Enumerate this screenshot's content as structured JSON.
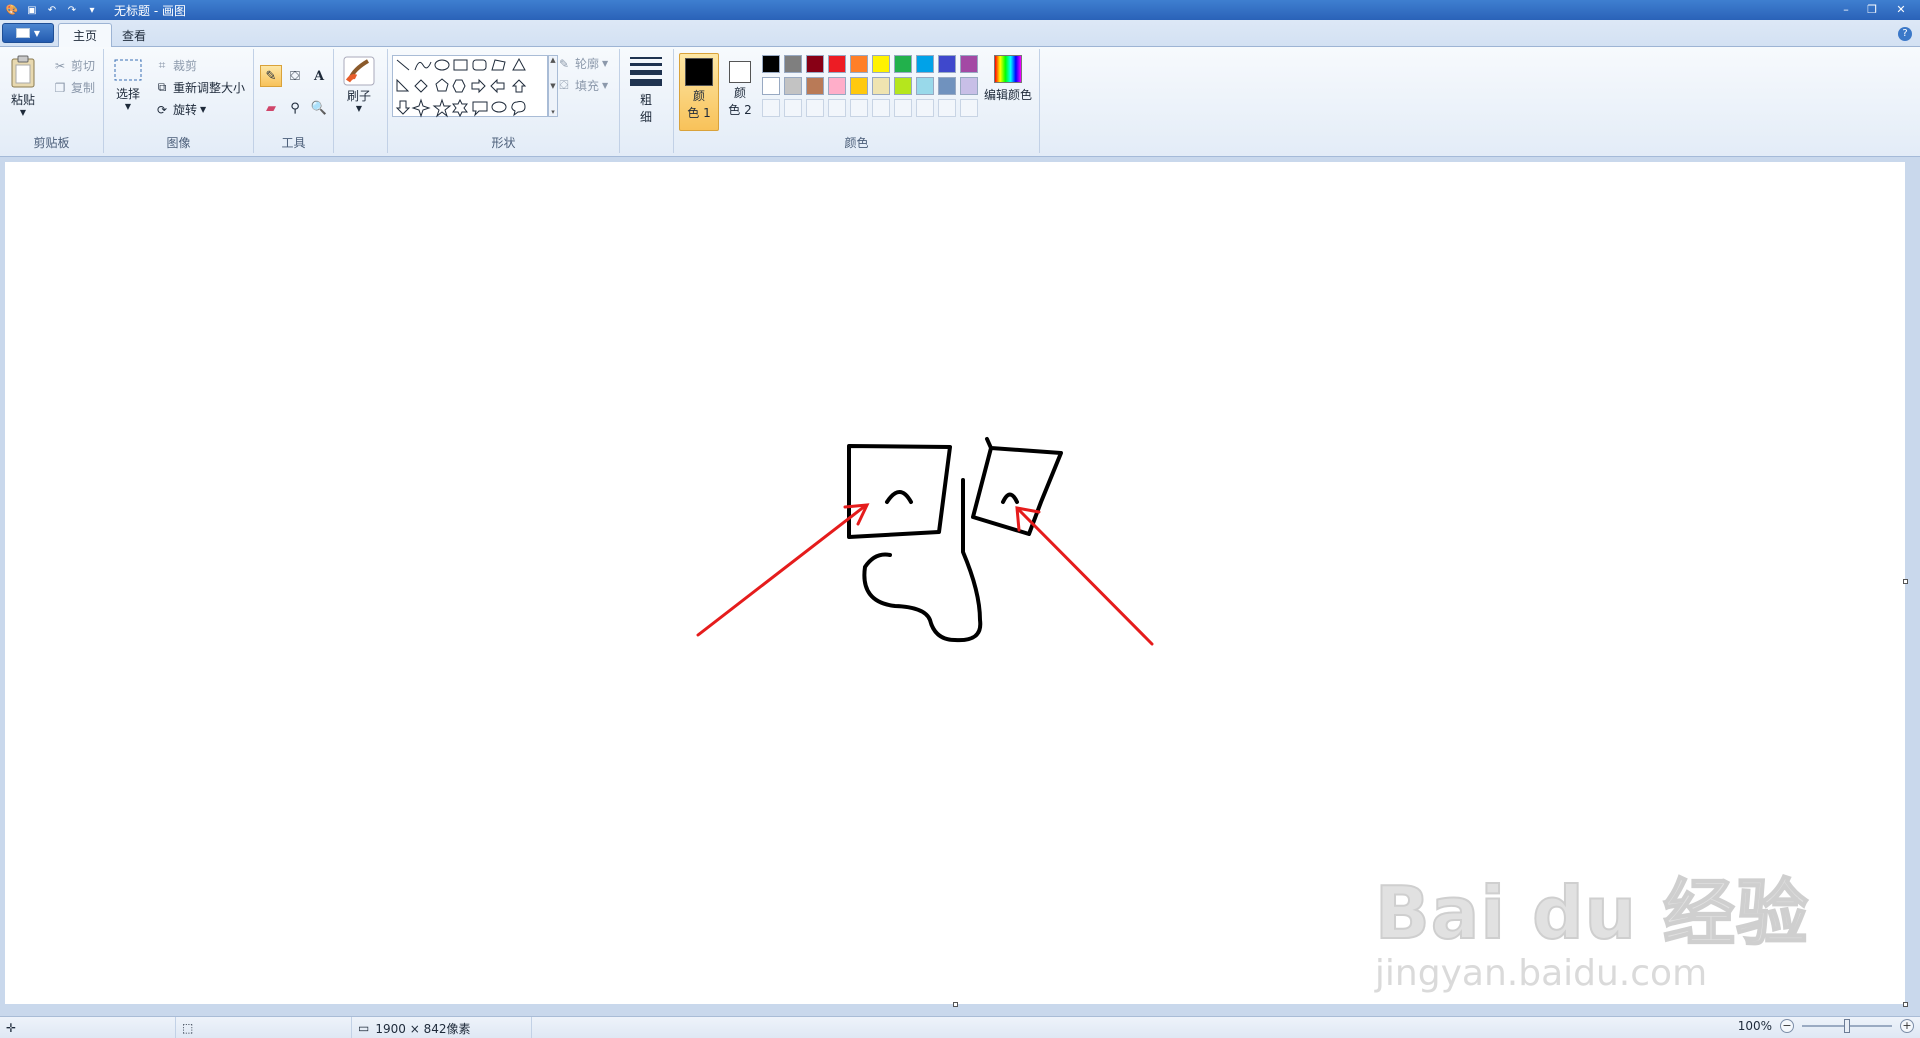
{
  "window": {
    "title": "无标题 - 画图",
    "controls": {
      "minimize": "–",
      "restore": "❐",
      "close": "✕"
    }
  },
  "tabs": [
    {
      "label": "主页",
      "active": true
    },
    {
      "label": "查看",
      "active": false
    }
  ],
  "ribbon": {
    "clipboard": {
      "paste": "粘贴",
      "cut": "剪切",
      "copy": "复制",
      "group": "剪贴板"
    },
    "image": {
      "select": "选择",
      "crop": "裁剪",
      "resize": "重新调整大小",
      "rotate": "旋转",
      "group": "图像"
    },
    "tools": {
      "group": "工具",
      "text_glyph": "A"
    },
    "brushes": {
      "label": "刷子"
    },
    "shapes": {
      "outline": "轮廓",
      "fill": "填充",
      "group": "形状"
    },
    "size": {
      "label_line1": "粗",
      "label_line2": "细"
    },
    "colors": {
      "color1_line1": "颜",
      "color1_line2": "色 1",
      "color1_value": "#000000",
      "color2_line1": "颜",
      "color2_line2": "色 2",
      "color2_value": "#ffffff",
      "edit": "编辑颜色",
      "group": "颜色",
      "palette": [
        "#000000",
        "#7f7f7f",
        "#880015",
        "#ed1c24",
        "#ff7f27",
        "#fff200",
        "#22b14c",
        "#00a2e8",
        "#3f48cc",
        "#a349a4",
        "#ffffff",
        "#c3c3c3",
        "#b97a57",
        "#ffaec9",
        "#ffc90e",
        "#efe4b0",
        "#b5e61d",
        "#99d9ea",
        "#7092be",
        "#c8bfe7"
      ]
    }
  },
  "canvas": {
    "annotation_color": "#e51c1c",
    "stroke_color": "#000000"
  },
  "watermark": {
    "main": "Bai du 经验",
    "sub": "jingyan.baidu.com"
  },
  "statusbar": {
    "dimensions": "1900 × 842像素",
    "zoom": "100%"
  }
}
